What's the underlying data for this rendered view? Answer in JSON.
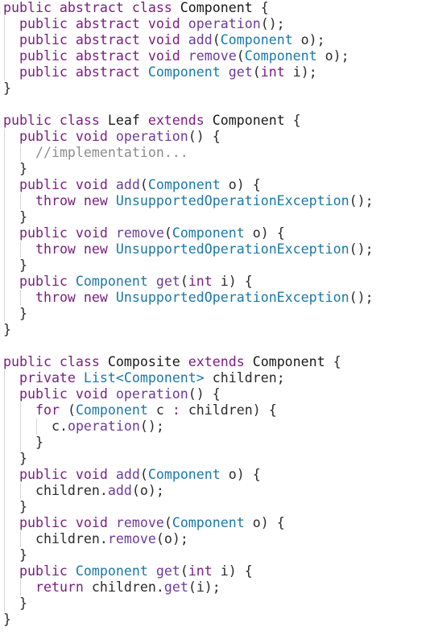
{
  "colors": {
    "background": "#ffffff",
    "keyword": "#7a1f80",
    "method": "#6c3c9a",
    "type": "#1c78a8",
    "identifier": "#2b2b2b",
    "comment": "#8c8c8c",
    "indent_guide": "#d6d6d6"
  },
  "code": {
    "lines": [
      {
        "indent": 0,
        "tokens": [
          [
            "kw",
            "public abstract class "
          ],
          [
            "cl",
            "Component"
          ],
          [
            "pu",
            " {"
          ]
        ]
      },
      {
        "indent": 1,
        "tokens": [
          [
            "kw",
            "public abstract void "
          ],
          [
            "fn",
            "operation"
          ],
          [
            "pu",
            "();"
          ]
        ]
      },
      {
        "indent": 1,
        "tokens": [
          [
            "kw",
            "public abstract void "
          ],
          [
            "fn",
            "add"
          ],
          [
            "pu",
            "("
          ],
          [
            "ty",
            "Component "
          ],
          [
            "id",
            "o"
          ],
          [
            "pu",
            ");"
          ]
        ]
      },
      {
        "indent": 1,
        "tokens": [
          [
            "kw",
            "public abstract void "
          ],
          [
            "fn",
            "remove"
          ],
          [
            "pu",
            "("
          ],
          [
            "ty",
            "Component "
          ],
          [
            "id",
            "o"
          ],
          [
            "pu",
            ");"
          ]
        ]
      },
      {
        "indent": 1,
        "tokens": [
          [
            "kw",
            "public abstract "
          ],
          [
            "ty",
            "Component "
          ],
          [
            "fn",
            "get"
          ],
          [
            "pu",
            "("
          ],
          [
            "kw",
            "int "
          ],
          [
            "id",
            "i"
          ],
          [
            "pu",
            ");"
          ]
        ]
      },
      {
        "indent": 0,
        "tokens": [
          [
            "pu",
            "}"
          ]
        ]
      },
      {
        "indent": 0,
        "tokens": []
      },
      {
        "indent": 0,
        "tokens": [
          [
            "kw",
            "public class "
          ],
          [
            "cl",
            "Leaf "
          ],
          [
            "kw",
            "extends "
          ],
          [
            "cl",
            "Component"
          ],
          [
            "pu",
            " {"
          ]
        ]
      },
      {
        "indent": 1,
        "tokens": [
          [
            "kw",
            "public void "
          ],
          [
            "fn",
            "operation"
          ],
          [
            "pu",
            "() {"
          ]
        ]
      },
      {
        "indent": 2,
        "tokens": [
          [
            "cm",
            "//implementation..."
          ]
        ]
      },
      {
        "indent": 1,
        "tokens": [
          [
            "pu",
            "}"
          ]
        ]
      },
      {
        "indent": 1,
        "tokens": [
          [
            "kw",
            "public void "
          ],
          [
            "fn",
            "add"
          ],
          [
            "pu",
            "("
          ],
          [
            "ty",
            "Component "
          ],
          [
            "id",
            "o"
          ],
          [
            "pu",
            ") {"
          ]
        ]
      },
      {
        "indent": 2,
        "tokens": [
          [
            "kw",
            "throw new "
          ],
          [
            "ty",
            "UnsupportedOperationException"
          ],
          [
            "pu",
            "();"
          ]
        ]
      },
      {
        "indent": 1,
        "tokens": [
          [
            "pu",
            "}"
          ]
        ]
      },
      {
        "indent": 1,
        "tokens": [
          [
            "kw",
            "public void "
          ],
          [
            "fn",
            "remove"
          ],
          [
            "pu",
            "("
          ],
          [
            "ty",
            "Component "
          ],
          [
            "id",
            "o"
          ],
          [
            "pu",
            ") {"
          ]
        ]
      },
      {
        "indent": 2,
        "tokens": [
          [
            "kw",
            "throw new "
          ],
          [
            "ty",
            "UnsupportedOperationException"
          ],
          [
            "pu",
            "();"
          ]
        ]
      },
      {
        "indent": 1,
        "tokens": [
          [
            "pu",
            "}"
          ]
        ]
      },
      {
        "indent": 1,
        "tokens": [
          [
            "kw",
            "public "
          ],
          [
            "ty",
            "Component "
          ],
          [
            "fn",
            "get"
          ],
          [
            "pu",
            "("
          ],
          [
            "kw",
            "int "
          ],
          [
            "id",
            "i"
          ],
          [
            "pu",
            ") {"
          ]
        ]
      },
      {
        "indent": 2,
        "tokens": [
          [
            "kw",
            "throw new "
          ],
          [
            "ty",
            "UnsupportedOperationException"
          ],
          [
            "pu",
            "();"
          ]
        ]
      },
      {
        "indent": 1,
        "tokens": [
          [
            "pu",
            "}"
          ]
        ]
      },
      {
        "indent": 0,
        "tokens": [
          [
            "pu",
            "}"
          ]
        ]
      },
      {
        "indent": 0,
        "tokens": []
      },
      {
        "indent": 0,
        "tokens": [
          [
            "kw",
            "public class "
          ],
          [
            "cl",
            "Composite "
          ],
          [
            "kw",
            "extends "
          ],
          [
            "cl",
            "Component"
          ],
          [
            "pu",
            " {"
          ]
        ]
      },
      {
        "indent": 1,
        "tokens": [
          [
            "kw",
            "private "
          ],
          [
            "ty",
            "List<Component> "
          ],
          [
            "id",
            "children"
          ],
          [
            "pu",
            ";"
          ]
        ]
      },
      {
        "indent": 1,
        "tokens": [
          [
            "kw",
            "public void "
          ],
          [
            "fn",
            "operation"
          ],
          [
            "pu",
            "() {"
          ]
        ]
      },
      {
        "indent": 2,
        "tokens": [
          [
            "kw",
            "for "
          ],
          [
            "pu",
            "("
          ],
          [
            "ty",
            "Component "
          ],
          [
            "id",
            "c "
          ],
          [
            "kw",
            ": "
          ],
          [
            "id",
            "children"
          ],
          [
            "pu",
            ") {"
          ]
        ]
      },
      {
        "indent": 3,
        "tokens": [
          [
            "id",
            "c"
          ],
          [
            "pu",
            "."
          ],
          [
            "fn",
            "operation"
          ],
          [
            "pu",
            "();"
          ]
        ]
      },
      {
        "indent": 2,
        "tokens": [
          [
            "pu",
            "}"
          ]
        ]
      },
      {
        "indent": 1,
        "tokens": [
          [
            "pu",
            "}"
          ]
        ]
      },
      {
        "indent": 1,
        "tokens": [
          [
            "kw",
            "public void "
          ],
          [
            "fn",
            "add"
          ],
          [
            "pu",
            "("
          ],
          [
            "ty",
            "Component "
          ],
          [
            "id",
            "o"
          ],
          [
            "pu",
            ") {"
          ]
        ]
      },
      {
        "indent": 2,
        "tokens": [
          [
            "id",
            "children"
          ],
          [
            "pu",
            "."
          ],
          [
            "fn",
            "add"
          ],
          [
            "pu",
            "(o);"
          ]
        ]
      },
      {
        "indent": 1,
        "tokens": [
          [
            "pu",
            "}"
          ]
        ]
      },
      {
        "indent": 1,
        "tokens": [
          [
            "kw",
            "public void "
          ],
          [
            "fn",
            "remove"
          ],
          [
            "pu",
            "("
          ],
          [
            "ty",
            "Component "
          ],
          [
            "id",
            "o"
          ],
          [
            "pu",
            ") {"
          ]
        ]
      },
      {
        "indent": 2,
        "tokens": [
          [
            "id",
            "children"
          ],
          [
            "pu",
            "."
          ],
          [
            "fn",
            "remove"
          ],
          [
            "pu",
            "(o);"
          ]
        ]
      },
      {
        "indent": 1,
        "tokens": [
          [
            "pu",
            "}"
          ]
        ]
      },
      {
        "indent": 1,
        "tokens": [
          [
            "kw",
            "public "
          ],
          [
            "ty",
            "Component "
          ],
          [
            "fn",
            "get"
          ],
          [
            "pu",
            "("
          ],
          [
            "kw",
            "int "
          ],
          [
            "id",
            "i"
          ],
          [
            "pu",
            ") {"
          ]
        ]
      },
      {
        "indent": 2,
        "tokens": [
          [
            "kw",
            "return "
          ],
          [
            "id",
            "children"
          ],
          [
            "pu",
            "."
          ],
          [
            "fn",
            "get"
          ],
          [
            "pu",
            "(i);"
          ]
        ]
      },
      {
        "indent": 1,
        "tokens": [
          [
            "pu",
            "}"
          ]
        ]
      },
      {
        "indent": 0,
        "tokens": [
          [
            "pu",
            "}"
          ]
        ]
      }
    ]
  }
}
